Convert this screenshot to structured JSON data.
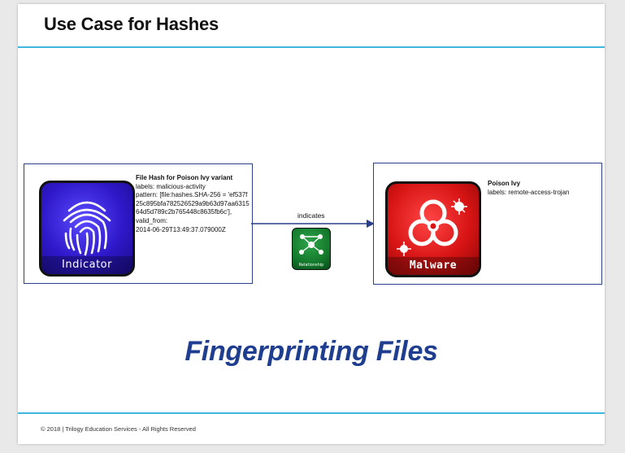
{
  "slide": {
    "title": "Use Case for Hashes",
    "headline": "Fingerprinting Files",
    "footer": "© 2018 | Trilogy Education Services - All Rights Reserved"
  },
  "indicator": {
    "tile_label": "Indicator",
    "icon": "fingerprint-icon",
    "name": "File Hash for Poison Ivy variant",
    "labels": "labels:  malicious-activity",
    "pattern": "pattern: [file:hashes.SHA-256 = 'ef537f25c895bfa782526529a9b63d97aa631564d5d789c2b765448c8635fb6c'],",
    "valid_from_label": "valid_from:",
    "valid_from": "2014-06-29T13:49:37.079000Z"
  },
  "relationship": {
    "label": "indicates",
    "icon_caption": "Relationship",
    "icon": "relationship-network-icon"
  },
  "malware": {
    "tile_label": "Malware",
    "icon": "biohazard-icon",
    "name": "Poison Ivy",
    "labels": "labels: remote-access-trojan"
  },
  "colors": {
    "accent_rule": "#3fb6dd",
    "headline": "#1f3e8f",
    "indicator_tile": "#2e18c9",
    "malware_tile": "#d81414",
    "relationship_tile": "#137a2c",
    "connector": "#2b3f8c"
  }
}
